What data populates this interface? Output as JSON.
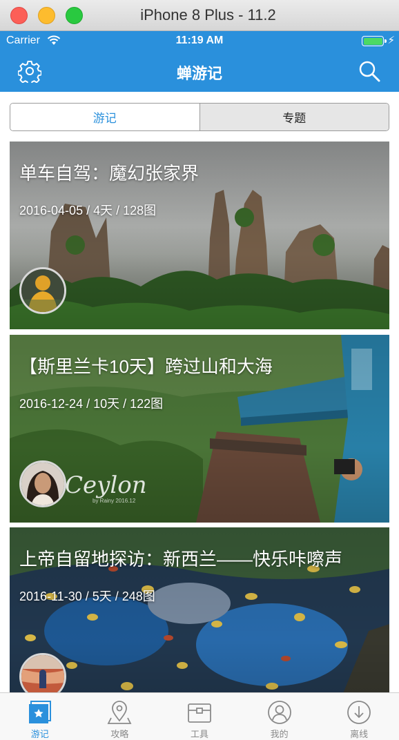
{
  "window": {
    "title": "iPhone 8 Plus - 11.2"
  },
  "status": {
    "carrier": "Carrier",
    "time": "11:19 AM",
    "battery_level": 1.0
  },
  "nav": {
    "title": "蝉游记",
    "left_icon": "gear-icon",
    "right_icon": "search-icon"
  },
  "segment": {
    "items": [
      "游记",
      "专题"
    ],
    "selected": 0
  },
  "cards": [
    {
      "title": "单车自驾：魔幻张家界",
      "meta": "2016-04-05 / 4天 / 128图"
    },
    {
      "title": "【斯里兰卡10天】跨过山和大海",
      "meta": "2016-12-24 / 10天 / 122图",
      "watermark": "Ceylon",
      "watermark_sub": "by Rainy 2016.12"
    },
    {
      "title": "上帝自留地探访：新西兰——快乐咔嚓声",
      "meta": "2016-11-30 / 5天 / 248图"
    }
  ],
  "tabbar": {
    "items": [
      {
        "label": "游记",
        "icon": "star-square-icon"
      },
      {
        "label": "攻略",
        "icon": "location-pin-icon"
      },
      {
        "label": "工具",
        "icon": "toolbox-icon"
      },
      {
        "label": "我的",
        "icon": "user-icon"
      },
      {
        "label": "离线",
        "icon": "download-icon"
      }
    ],
    "selected": 0
  },
  "colors": {
    "accent": "#2a90dc",
    "inactive": "#8a8a8a"
  }
}
